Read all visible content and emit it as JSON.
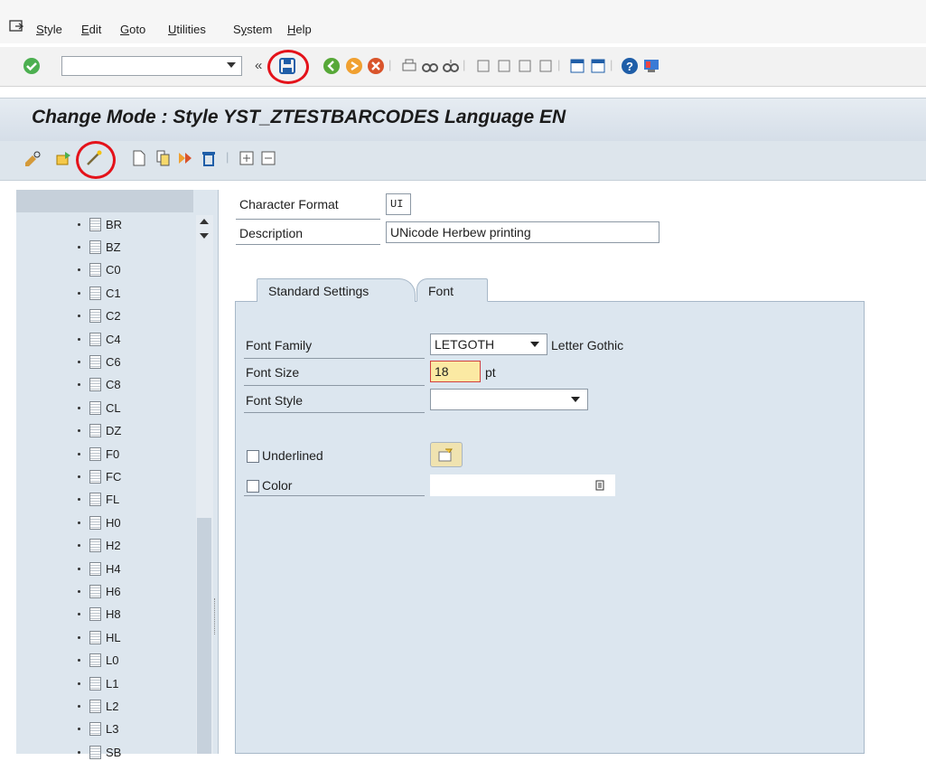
{
  "menubar": {
    "items": [
      {
        "label": "Style",
        "mnemonic": "S"
      },
      {
        "label": "Edit",
        "mnemonic": "E"
      },
      {
        "label": "Goto",
        "mnemonic": "G"
      },
      {
        "label": "Utilities",
        "mnemonic": "U"
      },
      {
        "label": "System",
        "mnemonic": "y"
      },
      {
        "label": "Help",
        "mnemonic": "H"
      }
    ]
  },
  "toolbar": {
    "command_value": "",
    "icons": [
      "enter-icon",
      "save-icon",
      "back-icon",
      "exit-icon",
      "cancel-icon",
      "print-icon",
      "find-icon",
      "find-next-icon",
      "first-page-icon",
      "previous-page-icon",
      "next-page-icon",
      "last-page-icon",
      "create-session-icon",
      "shortcut-icon",
      "help-icon",
      "customize-layout-icon"
    ]
  },
  "title": {
    "text": "Change Mode : Style YST_ZTESTBARCODES Language EN"
  },
  "app_toolbar": {
    "icons": [
      "display-change-icon",
      "activate-icon",
      "magic-wand-icon",
      "create-icon",
      "copy-icon",
      "deliver-icon",
      "delete-icon",
      "expand-icon",
      "collapse-icon"
    ]
  },
  "tree": {
    "items": [
      "BR",
      "BZ",
      "C0",
      "C1",
      "C2",
      "C4",
      "C6",
      "C8",
      "CL",
      "DZ",
      "F0",
      "FC",
      "FL",
      "H0",
      "H2",
      "H4",
      "H6",
      "H8",
      "HL",
      "L0",
      "L1",
      "L2",
      "L3",
      "SB"
    ]
  },
  "form": {
    "character_format_label": "Character Format",
    "character_format_value": "UI",
    "description_label": "Description",
    "description_value": "UNicode Herbew printing"
  },
  "tabs": [
    {
      "label": "Standard Settings",
      "active": false
    },
    {
      "label": "Font",
      "active": true
    }
  ],
  "font": {
    "family_label": "Font Family",
    "family_value": "LETGOTH",
    "family_text": "Letter Gothic",
    "size_label": "Font Size",
    "size_value": "18",
    "size_unit": "pt",
    "style_label": "Font Style",
    "style_value": "",
    "underlined_label": "Underlined",
    "color_label": "Color"
  },
  "colors": {
    "highlight": "#e4121a",
    "field_focus": "#fbe9a3",
    "panel": "#dce6ef",
    "title_bg": "#dae2ea"
  }
}
